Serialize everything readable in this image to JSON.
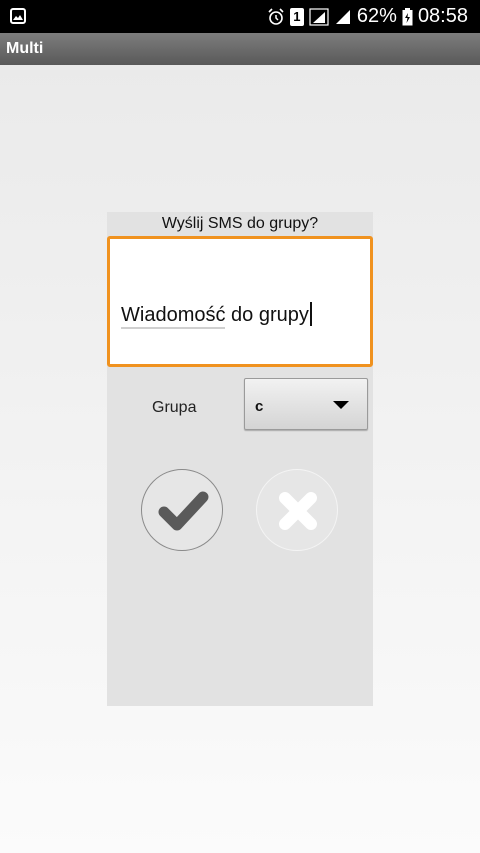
{
  "status_bar": {
    "battery_percent": "62%",
    "time": "08:58",
    "sim_slot": "1",
    "icons": [
      "image-icon",
      "alarm-icon",
      "sim-icon",
      "signal-icon",
      "signal-icon",
      "battery-icon"
    ]
  },
  "app": {
    "title": "Multi"
  },
  "dialog": {
    "title": "Wyślij SMS do grupy?",
    "message": {
      "value_underlined": "Wiadomość",
      "value_rest": " do grupy"
    },
    "group": {
      "label": "Grupa",
      "selected": "c"
    },
    "buttons": {
      "confirm_icon": "check-icon",
      "cancel_icon": "close-icon"
    }
  },
  "colors": {
    "focus_border": "#f0921f",
    "dialog_bg": "#e2e2e2",
    "status_bar": "#000000"
  }
}
